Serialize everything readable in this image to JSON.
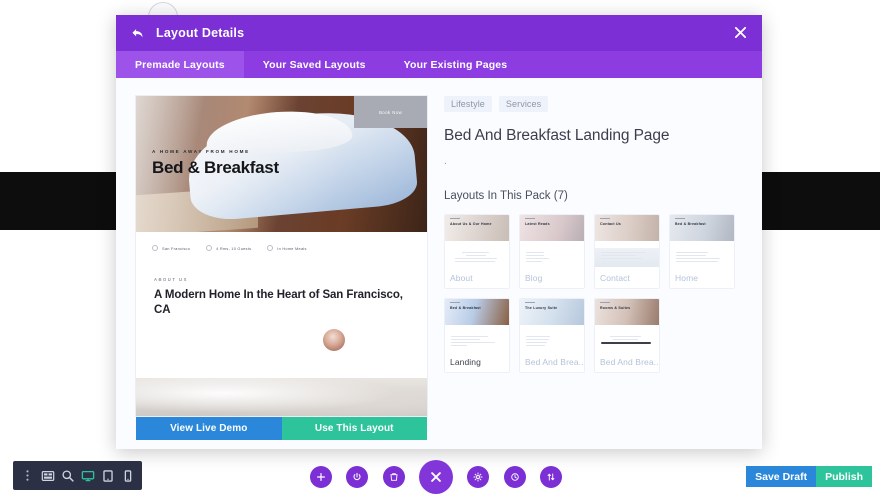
{
  "modal": {
    "title": "Layout Details",
    "back_icon": "back-arrow-icon",
    "close_icon": "close-icon",
    "tabs": [
      {
        "label": "Premade Layouts",
        "active": true
      },
      {
        "label": "Your Saved Layouts",
        "active": false
      },
      {
        "label": "Your Existing Pages",
        "active": false
      }
    ]
  },
  "preview": {
    "hero": {
      "eyebrow": "A HOME AWAY FROM HOME",
      "title": "Bed & Breakfast"
    },
    "info_items": [
      {
        "icon": "pin-icon",
        "text": "San Francisco"
      },
      {
        "icon": "bed-icon",
        "text": "4 Rms, 10 Guests"
      },
      {
        "icon": "meal-icon",
        "text": "In Home Meals"
      }
    ],
    "book_button": "Book Now",
    "about": {
      "eyebrow": "ABOUT US",
      "title": "A Modern Home In the Heart of San Francisco, CA"
    },
    "buttons": {
      "demo": "View Live Demo",
      "use": "Use This Layout"
    }
  },
  "details": {
    "tags": [
      "Lifestyle",
      "Services"
    ],
    "pack_title": "Bed And Breakfast Landing Page",
    "pack_description": ".",
    "pack_section_label": "Layouts In This Pack (7)",
    "cards": [
      {
        "label": "About",
        "active": false,
        "thumb_title": "About Us\n& Our Home",
        "hue": "#efe7e3"
      },
      {
        "label": "Blog",
        "active": false,
        "thumb_title": "Latest Reads",
        "hue": "#efe4e6"
      },
      {
        "label": "Contact",
        "active": false,
        "thumb_title": "Contact Us",
        "hue": "#e8dfdc"
      },
      {
        "label": "Home",
        "active": false,
        "thumb_title": "Bed & Breakfast",
        "hue": "#e3e6ec"
      },
      {
        "label": "Landing",
        "active": true,
        "thumb_title": "Bed & Breakfast",
        "hue": "#d9e3f2"
      },
      {
        "label": "Bed And Brea...",
        "active": false,
        "thumb_title": "The Luxury Suite",
        "hue": "#e6ecf4"
      },
      {
        "label": "Bed And Brea...",
        "active": false,
        "thumb_title": "Rooms & Suites",
        "hue": "#e7dedb"
      }
    ]
  },
  "left_toolbar": {
    "items": [
      {
        "icon": "drag-handle-icon",
        "name": "drag-handle"
      },
      {
        "icon": "wireframe-icon",
        "name": "wireframe-view"
      },
      {
        "icon": "zoom-out-icon",
        "name": "zoom-view"
      },
      {
        "icon": "desktop-icon",
        "name": "desktop-view",
        "active": true
      },
      {
        "icon": "tablet-icon",
        "name": "tablet-view"
      },
      {
        "icon": "phone-icon",
        "name": "phone-view"
      }
    ]
  },
  "center_bar": {
    "items": [
      {
        "icon": "plus-icon",
        "name": "add-section"
      },
      {
        "icon": "power-icon",
        "name": "toggle-builder"
      },
      {
        "icon": "trash-icon",
        "name": "delete"
      },
      {
        "icon": "close-icon",
        "name": "close-menu",
        "big": true
      },
      {
        "icon": "gear-icon",
        "name": "settings"
      },
      {
        "icon": "history-icon",
        "name": "editing-history"
      },
      {
        "icon": "sort-icon",
        "name": "portability"
      }
    ]
  },
  "footer_actions": {
    "save_draft": "Save Draft",
    "publish": "Publish"
  }
}
